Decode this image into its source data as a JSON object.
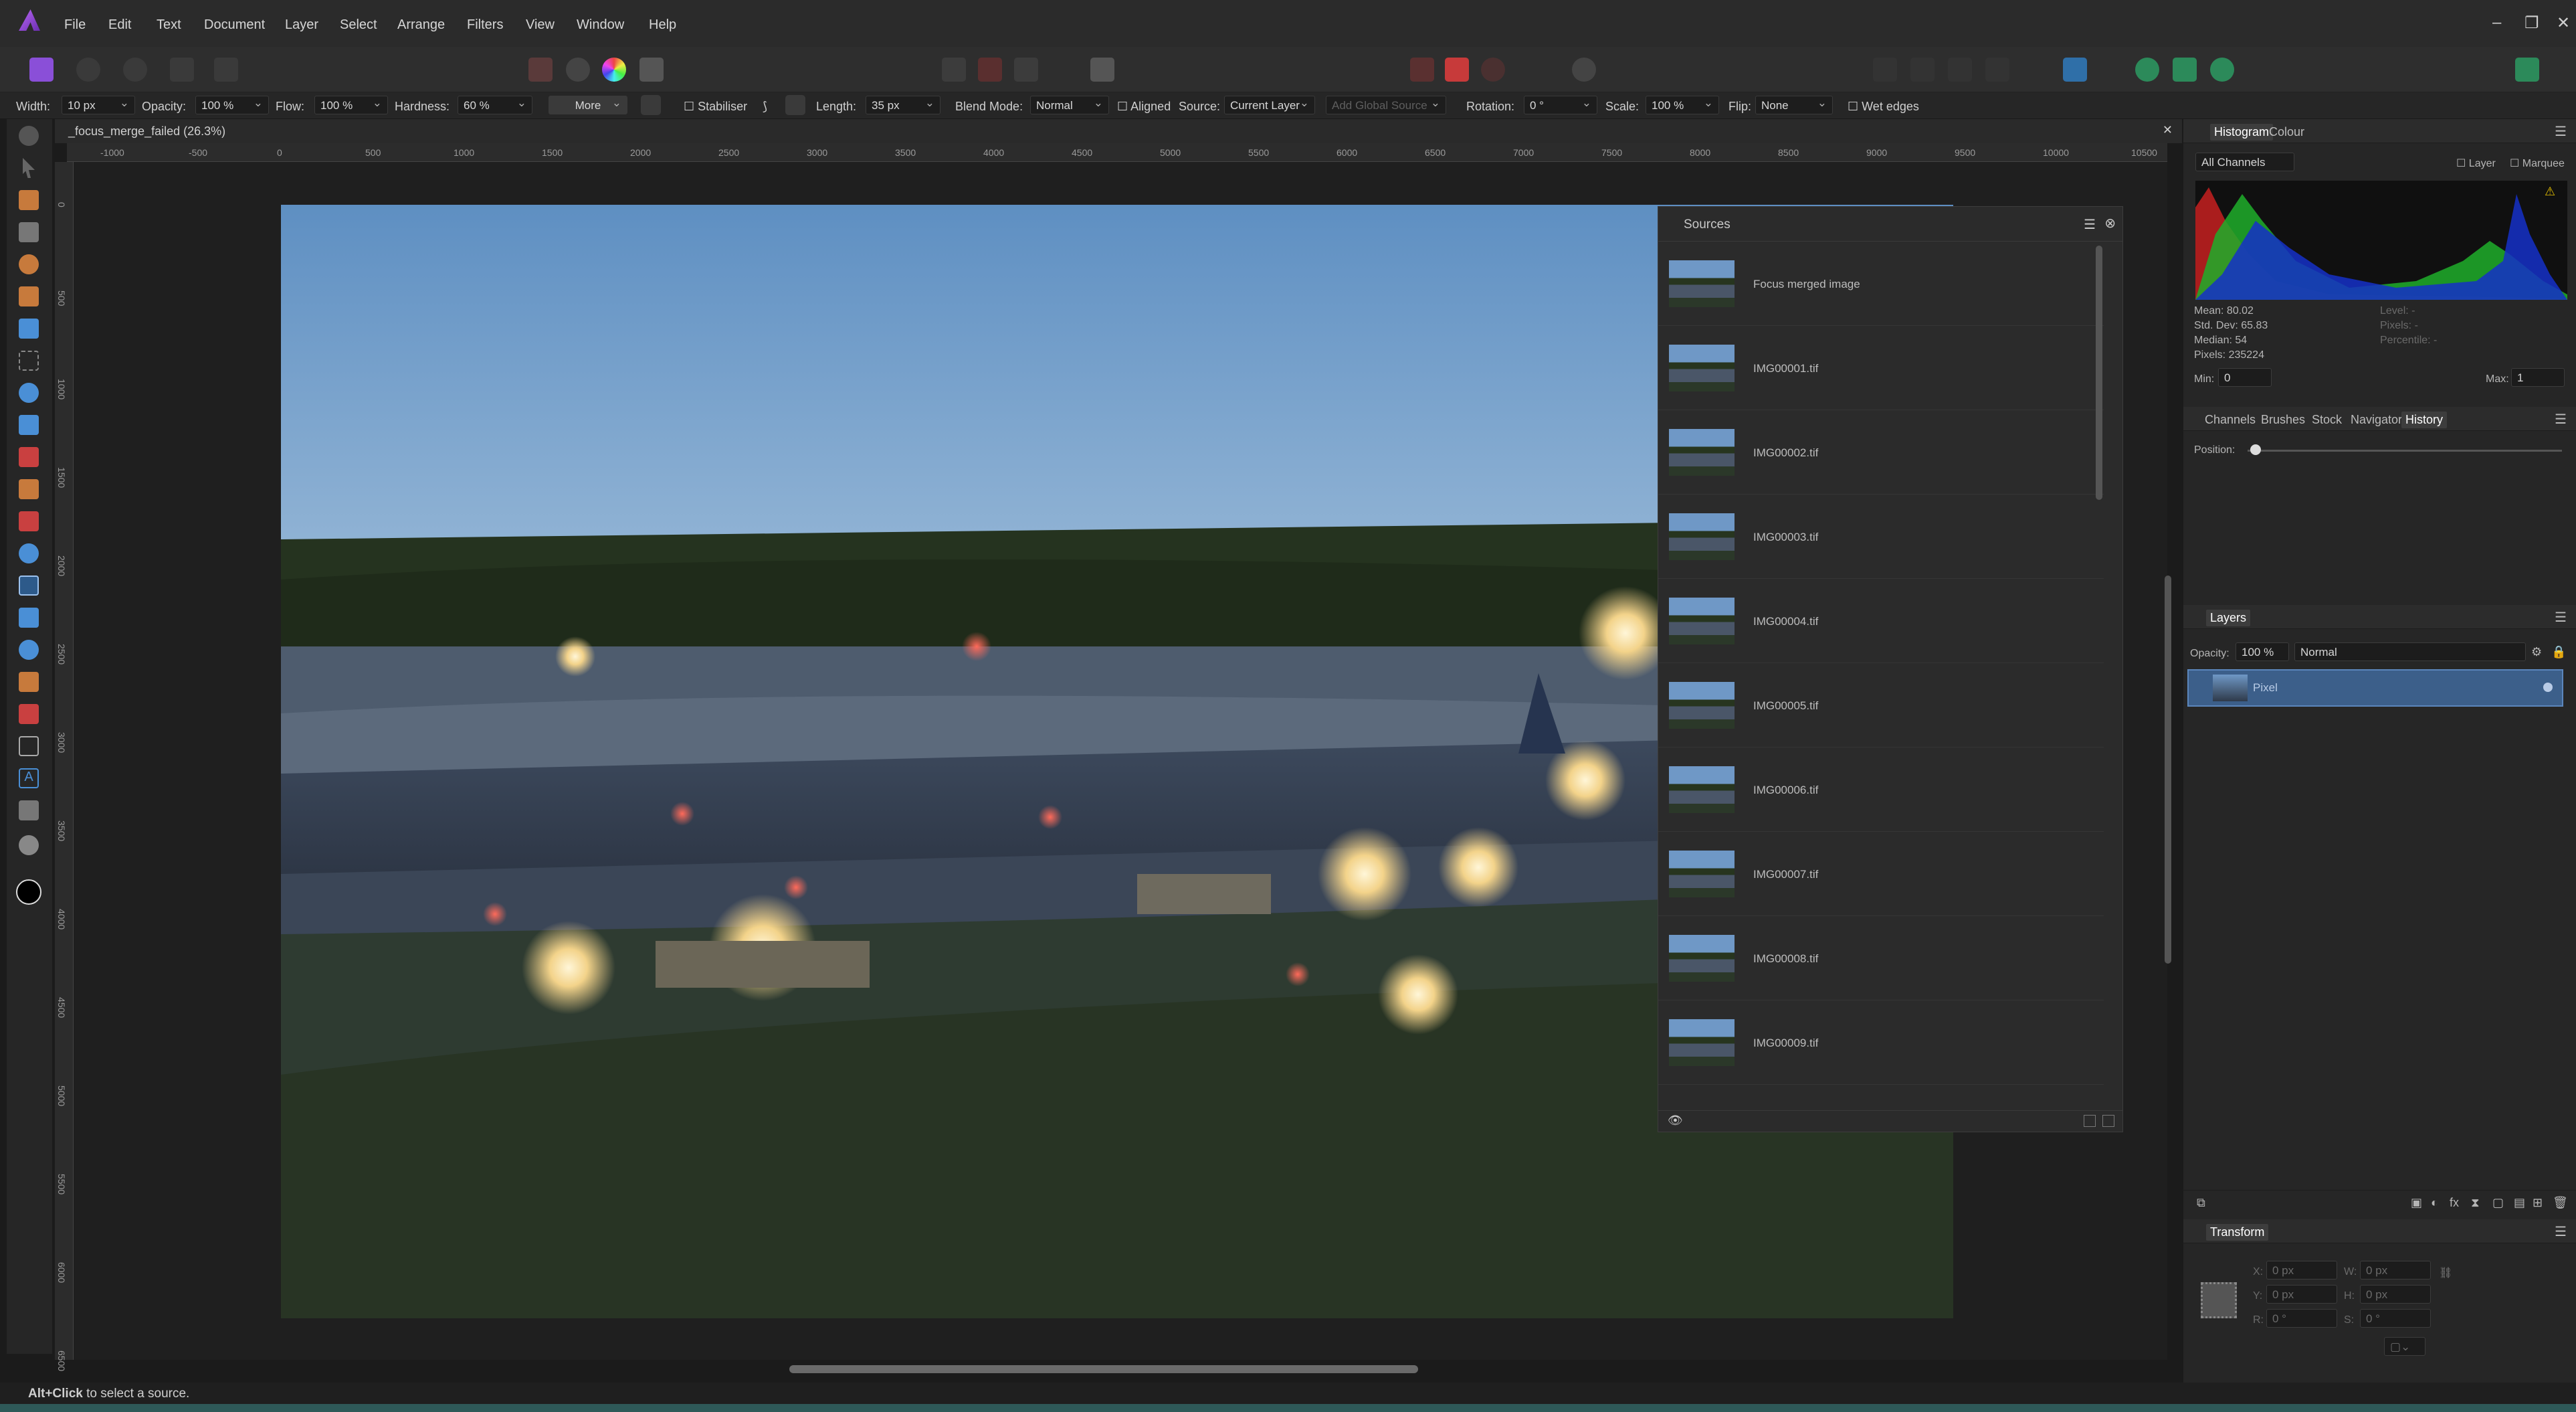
{
  "menu": [
    "File",
    "Edit",
    "Text",
    "Document",
    "Layer",
    "Select",
    "Arrange",
    "Filters",
    "View",
    "Window",
    "Help"
  ],
  "window_controls": [
    "–",
    "❐",
    "✕"
  ],
  "context": {
    "width_label": "Width:",
    "width": "10 px",
    "opacity_label": "Opacity:",
    "opacity": "100 %",
    "flow_label": "Flow:",
    "flow": "100 %",
    "hardness_label": "Hardness:",
    "hardness": "60 %",
    "more": "More",
    "stabiliser": "Stabiliser",
    "length_label": "Length:",
    "length": "35 px",
    "blend_label": "Blend Mode:",
    "blend": "Normal",
    "aligned": "Aligned",
    "source_label": "Source:",
    "source": "Current Layer",
    "add_global": "Add Global Source",
    "rotation_label": "Rotation:",
    "rotation": "0 °",
    "scale_label": "Scale:",
    "scale": "100 %",
    "flip_label": "Flip:",
    "flip": "None",
    "wet_edges": "Wet edges"
  },
  "document": {
    "tab": "_focus_merge_failed (26.3%)",
    "close": "✕"
  },
  "ruler_h": [
    "-1000",
    "-500",
    "0",
    "500",
    "1000",
    "1500",
    "2000",
    "2500",
    "3000",
    "3500",
    "4000",
    "4500",
    "5000",
    "5500",
    "6000",
    "6500",
    "7000",
    "7500",
    "8000",
    "8500",
    "9000",
    "9500",
    "10000",
    "10500"
  ],
  "ruler_v": [
    "0",
    "500",
    "1000",
    "1500",
    "2000",
    "2500",
    "3000",
    "3500",
    "4000",
    "4500",
    "5000",
    "5500",
    "6000",
    "6500"
  ],
  "sources_panel": {
    "title": "Sources",
    "items": [
      "Focus merged image",
      "IMG00001.tif",
      "IMG00002.tif",
      "IMG00003.tif",
      "IMG00004.tif",
      "IMG00005.tif",
      "IMG00006.tif",
      "IMG00007.tif",
      "IMG00008.tif",
      "IMG00009.tif"
    ]
  },
  "histogram": {
    "tabs": [
      "Histogram",
      "Colour"
    ],
    "channel": "All Channels",
    "layer": "Layer",
    "marquee": "Marquee",
    "mean": "Mean: 80.02",
    "std": "Std. Dev: 65.83",
    "median": "Median: 54",
    "pixels": "Pixels: 235224",
    "level": "Level: -",
    "pixels_r": "Pixels: -",
    "percentile": "Percentile: -",
    "min_label": "Min:",
    "min": "0",
    "max_label": "Max:",
    "max": "1"
  },
  "history": {
    "tabs": [
      "Channels",
      "Brushes",
      "Stock",
      "Navigator",
      "History"
    ],
    "position": "Position:"
  },
  "layers": {
    "title": "Layers",
    "opacity_label": "Opacity:",
    "opacity": "100 %",
    "blend": "Normal",
    "layer_name": "Pixel"
  },
  "transform": {
    "title": "Transform",
    "x_label": "X:",
    "x": "0 px",
    "y_label": "Y:",
    "y": "0 px",
    "w_label": "W:",
    "w": "0 px",
    "h_label": "H:",
    "h": "0 px",
    "r_label": "R:",
    "r": "0 °",
    "s_label": "S:",
    "s": "0 °"
  },
  "status": {
    "key": "Alt+Click",
    "text": " to select a source."
  },
  "colors": {
    "accent": "#b968f4",
    "selection": "#3c5f8a",
    "panel": "#262626"
  }
}
